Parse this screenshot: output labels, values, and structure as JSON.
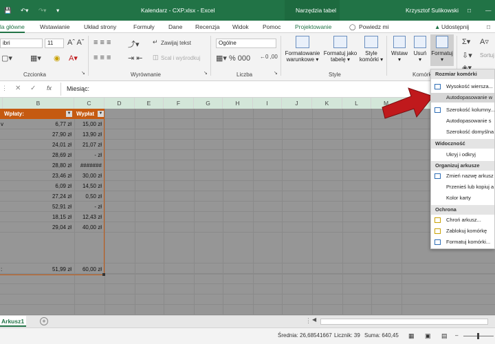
{
  "titlebar": {
    "home_tab_partial": "la główne",
    "file_title": "Kalendarz - CXP.xlsx - Excel",
    "context_group": "Narzędzia tabel",
    "user": "Krzysztof Sulikowski"
  },
  "tabs": [
    "la główne",
    "Wstawianie",
    "Układ strony",
    "Formuły",
    "Dane",
    "Recenzja",
    "Widok",
    "Pomoc",
    "Projektowanie"
  ],
  "tell_me": "Powiedz mi",
  "share": "Udostępnij",
  "ribbon": {
    "font_name": "ibri",
    "font_size": "11",
    "wrap_text": "Zawijaj tekst",
    "merge": "Scal i wyśrodkuj",
    "number_format": "Ogólne",
    "cond_format": [
      "Formatowanie",
      "warunkowe"
    ],
    "format_table": [
      "Formatuj jako",
      "tabelę"
    ],
    "cell_styles": [
      "Style",
      "komórki"
    ],
    "insert": "Wstaw",
    "delete": "Usuń",
    "format": "Formatuj",
    "sort_filter": "Sortuj i",
    "groups": {
      "font": "Czcionka",
      "alignment": "Wyrównanie",
      "number": "Liczba",
      "styles": "Style",
      "cells": "Komórki"
    }
  },
  "formula_bar": {
    "content": "Miesiąc:"
  },
  "columns": [
    "B",
    "C",
    "D",
    "E",
    "F",
    "G",
    "H",
    "I",
    "J",
    "K",
    "L",
    "M"
  ],
  "table": {
    "headers": [
      "Wpłaty:",
      "Wypłat"
    ],
    "rows": [
      {
        "a": "v",
        "b": "6,77 zł",
        "c": "15,00 zł"
      },
      {
        "a": "",
        "b": "27,90 zł",
        "c": "13,90 zł"
      },
      {
        "a": "",
        "b": "24,01 zł",
        "c": "21,07 zł"
      },
      {
        "a": "",
        "b": "28,69 zł",
        "c": "-    zł"
      },
      {
        "a": "",
        "b": "28,80 zł",
        "c": "#######"
      },
      {
        "a": "",
        "b": "23,46 zł",
        "c": "30,00 zł"
      },
      {
        "a": "",
        "b": "6,09 zł",
        "c": "14,50 zł"
      },
      {
        "a": "",
        "b": "27,24 zł",
        "c": "0,50 zł"
      },
      {
        "a": "",
        "b": "52,91 zł",
        "c": "-    zł"
      },
      {
        "a": "",
        "b": "18,15 zł",
        "c": "12,43 zł"
      },
      {
        "a": "",
        "b": "29,04 zł",
        "c": "40,00 zł"
      }
    ],
    "total_label": ":",
    "total_b": "51,99 zł",
    "total_c": "60,00 zł"
  },
  "menu": {
    "sections": [
      {
        "header": "Rozmiar komórki",
        "items": [
          {
            "label": "Wysokość wiersza...",
            "icon": "row-height-icon"
          },
          {
            "label": "Autodopasowanie w",
            "icon": "",
            "highlight": true
          },
          {
            "label": "Szerokość kolumny...",
            "icon": "col-width-icon"
          },
          {
            "label": "Autodopasowanie s",
            "icon": ""
          },
          {
            "label": "Szerokość domyślna",
            "icon": ""
          }
        ]
      },
      {
        "header": "Widoczność",
        "items": [
          {
            "label": "Ukryj i odkryj",
            "icon": ""
          }
        ]
      },
      {
        "header": "Organizuj arkusze",
        "items": [
          {
            "label": "Zmień nazwę arkusz",
            "icon": "rename-sheet-icon"
          },
          {
            "label": "Przenieś lub kopiuj a",
            "icon": ""
          },
          {
            "label": "Kolor karty",
            "icon": ""
          }
        ]
      },
      {
        "header": "Ochrona",
        "items": [
          {
            "label": "Chroń arkusz...",
            "icon": "protect-sheet-icon"
          },
          {
            "label": "Zablokuj komórkę",
            "icon": "lock-icon"
          },
          {
            "label": "Formatuj komórki...",
            "icon": "format-cells-icon"
          }
        ]
      }
    ]
  },
  "sheet_tab": "Arkusz1",
  "status": {
    "average": "Średnia: 26,68541667",
    "count": "Licznik: 39",
    "sum": "Suma: 640,45"
  },
  "colors": {
    "excel_green": "#217346",
    "table_header": "#c55a11",
    "arrow": "#c0191c"
  }
}
